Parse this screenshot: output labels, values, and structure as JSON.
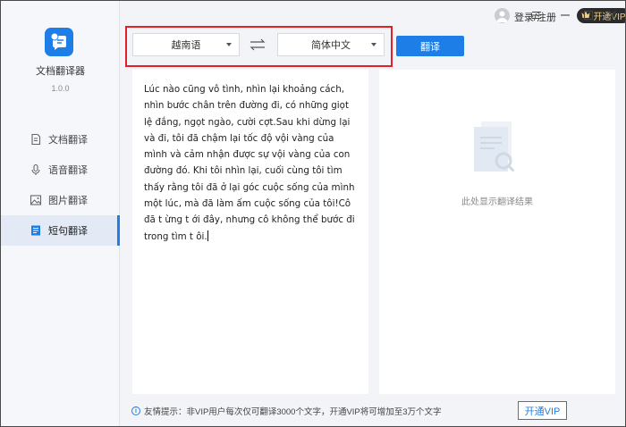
{
  "app": {
    "name": "文档翻译器",
    "version": "1.0.0"
  },
  "nav": {
    "items": [
      {
        "label": "文档翻译",
        "icon": "document-icon",
        "active": false
      },
      {
        "label": "语音翻译",
        "icon": "microphone-icon",
        "active": false
      },
      {
        "label": "图片翻译",
        "icon": "image-icon",
        "active": false
      },
      {
        "label": "短句翻译",
        "icon": "text-icon",
        "active": true
      }
    ]
  },
  "header": {
    "login_label": "登录/注册",
    "vip_label": "开通VIP"
  },
  "translate": {
    "source_language": "越南语",
    "target_language": "简体中文",
    "button_label": "翻译",
    "source_text": "Lúc nào cũng vô tình, nhìn lại khoảng cách, nhìn bước chân trên đường đi, có những giọt lệ đắng, ngọt ngào, cười cợt.Sau khi dừng lại và đi, tôi đã chậm lại tốc độ vội vàng của mình và cảm nhận được sự vội vàng của con đường đó. Khi tôi nhìn lại, cuối cùng tôi tìm thấy rằng tôi đã ở lại góc cuộc sống của mình một lúc, mà đã làm ấm cuộc sống của tôi!Cô đã t ừng t ới đây, nhưng cô không thể bước đi trong tìm t ôi.",
    "result_placeholder": "此处显示翻译结果"
  },
  "footer": {
    "tip": "友情提示：非VIP用户每次仅可翻译3000个文字，开通VIP将可增加至3万个文字",
    "vip_button": "开通VIP"
  },
  "colors": {
    "accent": "#1e7ee8",
    "highlight_frame": "#e0212a",
    "vip_gold": "#f1cf8a"
  }
}
